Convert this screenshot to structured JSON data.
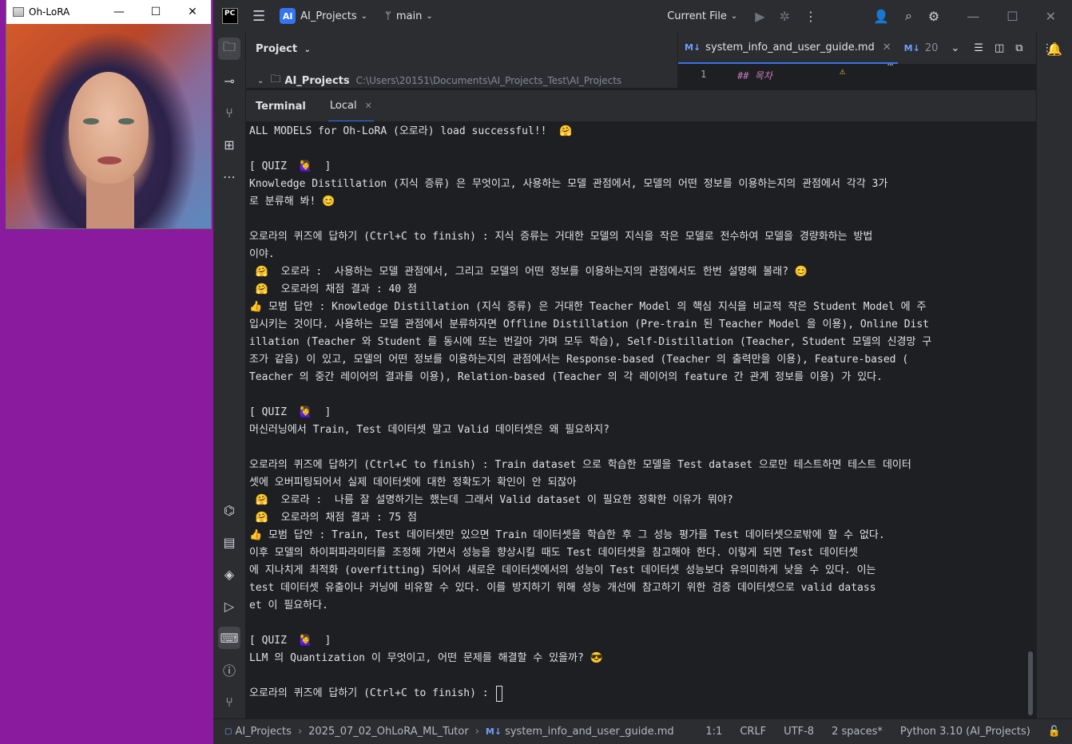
{
  "ohlora_window": {
    "title": "Oh-LoRA",
    "minimize": "—",
    "maximize": "☐",
    "close": "✕"
  },
  "ide": {
    "logo": "PC",
    "project_badge": "AI",
    "project_name": "AI_Projects",
    "branch": "main",
    "run_config": "Current File",
    "project_panel": {
      "header": "Project",
      "root_name": "AI_Projects",
      "root_path": "C:\\Users\\20151\\Documents\\AI_Projects_Test\\AI_Projects"
    },
    "editor": {
      "tabs": [
        {
          "badge": "M↓",
          "label": "system_info_and_user_guide.md"
        },
        {
          "badge": "M↓",
          "label": "20"
        }
      ],
      "line_number": "1",
      "line_text": "## 목차"
    },
    "terminal": {
      "title": "Terminal",
      "tab": "Local",
      "lines": [
        "ALL MODELS for Oh-LoRA (오로라) load successful!!  🤗",
        "",
        "[ QUIZ  🙋‍♀️  ]",
        "Knowledge Distillation (지식 증류) 은 무엇이고, 사용하는 모델 관점에서, 모델의 어떤 정보를 이용하는지의 관점에서 각각 3가",
        "로 분류해 봐! 😊",
        "",
        "오로라의 퀴즈에 답하기 (Ctrl+C to finish) : 지식 증류는 거대한 모델의 지식을 작은 모델로 전수하여 모델을 경량화하는 방법",
        "이야.",
        " 🤗  오로라 :  사용하는 모델 관점에서, 그리고 모델의 어떤 정보를 이용하는지의 관점에서도 한번 설명해 볼래? 😊",
        " 🤗  오로라의 채점 결과 : 40 점",
        "👍 모범 답안 : Knowledge Distillation (지식 증류) 은 거대한 Teacher Model 의 핵심 지식을 비교적 작은 Student Model 에 주",
        "입시키는 것이다. 사용하는 모델 관점에서 분류하자면 Offline Distillation (Pre-train 된 Teacher Model 을 이용), Online Dist",
        "illation (Teacher 와 Student 를 동시에 또는 번갈아 가며 모두 학습), Self-Distillation (Teacher, Student 모델의 신경망 구",
        "조가 같음) 이 있고, 모델의 어떤 정보를 이용하는지의 관점에서는 Response-based (Teacher 의 출력만을 이용), Feature-based (",
        "Teacher 의 중간 레이어의 결과를 이용), Relation-based (Teacher 의 각 레이어의 feature 간 관계 정보를 이용) 가 있다.",
        "",
        "[ QUIZ  🙋‍♀️  ]",
        "머신러닝에서 Train, Test 데이터셋 말고 Valid 데이터셋은 왜 필요하지?",
        "",
        "오로라의 퀴즈에 답하기 (Ctrl+C to finish) : Train dataset 으로 학습한 모델을 Test dataset 으로만 테스트하면 테스트 데이터",
        "셋에 오버피팅되어서 실제 데이터셋에 대한 정확도가 확인이 안 되잖아",
        " 🤗  오로라 :  나름 잘 설명하기는 했는데 그래서 Valid dataset 이 필요한 정확한 이유가 뭐야?",
        " 🤗  오로라의 채점 결과 : 75 점",
        "👍 모범 답안 : Train, Test 데이터셋만 있으면 Train 데이터셋을 학습한 후 그 성능 평가를 Test 데이터셋으로밖에 할 수 없다.",
        "이후 모델의 하이퍼파라미터를 조정해 가면서 성능을 향상시킬 때도 Test 데이터셋을 참고해야 한다. 이렇게 되면 Test 데이터셋",
        "에 지나치게 최적화 (overfitting) 되어서 새로운 데이터셋에서의 성능이 Test 데이터셋 성능보다 유의미하게 낮을 수 있다. 이는",
        "test 데이터셋 유출이나 커닝에 비유할 수 있다. 이를 방지하기 위해 성능 개선에 참고하기 위한 검증 데이터셋으로 valid datass",
        "et 이 필요하다.",
        "",
        "[ QUIZ  🙋‍♀️  ]",
        "LLM 의 Quantization 이 무엇이고, 어떤 문제를 해결할 수 있을까? 😎",
        ""
      ],
      "prompt": "오로라의 퀴즈에 답하기 (Ctrl+C to finish) : "
    },
    "statusbar": {
      "breadcrumb": [
        "AI_Projects",
        "2025_07_02_OhLoRA_ML_Tutor",
        "system_info_and_user_guide.md"
      ],
      "position": "1:1",
      "line_ending": "CRLF",
      "encoding": "UTF-8",
      "indent": "2 spaces*",
      "interpreter": "Python 3.10 (AI_Projects)"
    },
    "colors": {
      "accent": "#3574f0",
      "bg": "#1e1f22",
      "panel": "#2b2d30",
      "desktop": "#8a1a9e"
    }
  }
}
